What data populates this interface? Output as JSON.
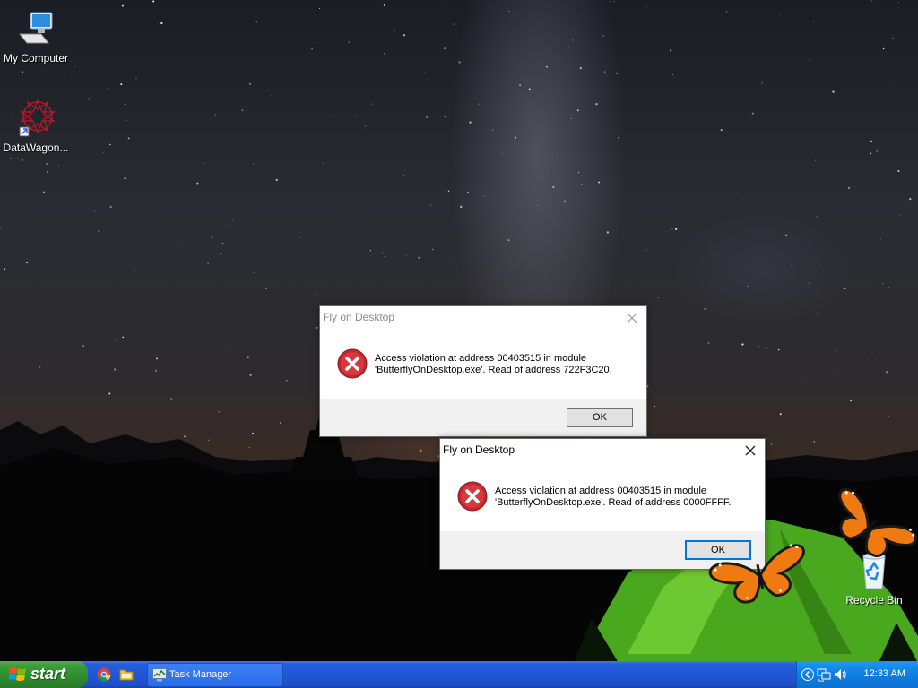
{
  "desktop": {
    "icons": [
      {
        "label": "My Computer"
      },
      {
        "label": "DataWagon..."
      },
      {
        "label": "Recycle Bin"
      }
    ]
  },
  "dialogs": [
    {
      "title": "Fly on Desktop",
      "message_line1": "Access violation at address 00403515 in module",
      "message_line2": "'ButterflyOnDesktop.exe'. Read of address 722F3C20.",
      "ok_label": "OK",
      "icon": "error-icon"
    },
    {
      "title": "Fly on Desktop",
      "message_line1": "Access violation at address 00403515 in module",
      "message_line2": "'ButterflyOnDesktop.exe'. Read of address 0000FFFF.",
      "ok_label": "OK",
      "icon": "error-icon"
    }
  ],
  "taskbar": {
    "start_label": "start",
    "quick_launch": [
      "chrome-icon",
      "folder-icon"
    ],
    "task_button": "Task Manager",
    "tray_icons": [
      "chevron-left-icon",
      "network-icon",
      "volume-icon"
    ],
    "clock": "12:33 AM"
  },
  "colors": {
    "taskbar_blue": "#245edb",
    "start_green": "#3c9e3c",
    "error_red": "#c4262e",
    "focus_blue": "#0078d7",
    "butterfly_orange": "#f07a12"
  }
}
